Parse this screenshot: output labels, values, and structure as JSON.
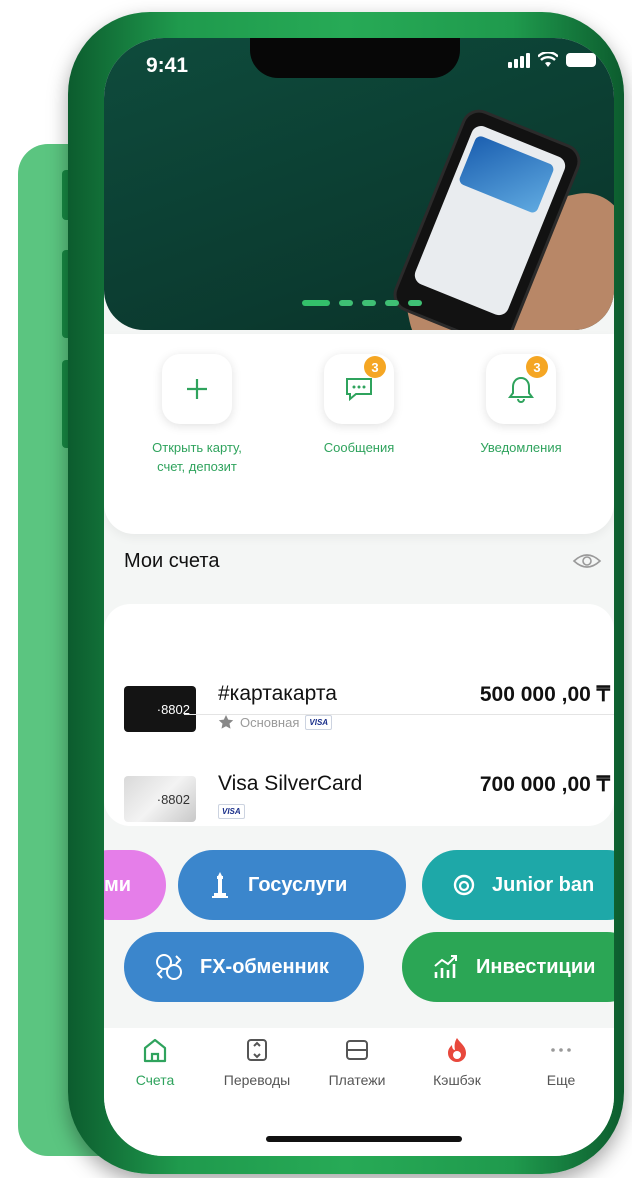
{
  "status_bar": {
    "time": "9:41"
  },
  "carousel": {
    "slides": 5,
    "active": 1
  },
  "colors": {
    "brand_green": "#27aa56",
    "label_green": "#2fa35d",
    "badge": "#f5a623"
  },
  "quick_actions": [
    {
      "label": "Открыть карту,\nсчет, депозит",
      "icon": "plus-icon"
    },
    {
      "label": "Сообщения",
      "icon": "chat-icon",
      "badge": "3"
    },
    {
      "label": "Уведомления",
      "icon": "bell-icon",
      "badge": "3"
    }
  ],
  "accounts_section": {
    "title": "Мои счета",
    "icon": "eye-icon"
  },
  "accounts": [
    {
      "card_suffix": "·8802",
      "name": "#картакарта",
      "amount": "500 000 ,00 ₸",
      "tag": "Основная",
      "network": "VISA"
    },
    {
      "card_suffix": "·8802",
      "name": "Visa SilverCard",
      "amount": "700 000 ,00 ₸",
      "network": "VISA"
    }
  ],
  "services": [
    {
      "label": "ми",
      "color": "#e57ee9"
    },
    {
      "label": "Госуслуги",
      "color": "#3b86cc",
      "icon": "monument-icon"
    },
    {
      "label": "Junior ban",
      "color": "#1ea8a8",
      "icon": "junior-icon"
    },
    {
      "label": "FX-обменник",
      "color": "#3b86cc",
      "icon": "exchange-icon"
    },
    {
      "label": "Инвестиции",
      "color": "#2ba655",
      "icon": "chart-up-icon"
    }
  ],
  "tabs": [
    {
      "label": "Счета",
      "icon": "home-icon",
      "active": true
    },
    {
      "label": "Переводы",
      "icon": "transfer-icon"
    },
    {
      "label": "Платежи",
      "icon": "payment-icon"
    },
    {
      "label": "Кэшбэк",
      "icon": "fire-icon"
    },
    {
      "label": "Еще",
      "icon": "more-icon"
    }
  ]
}
